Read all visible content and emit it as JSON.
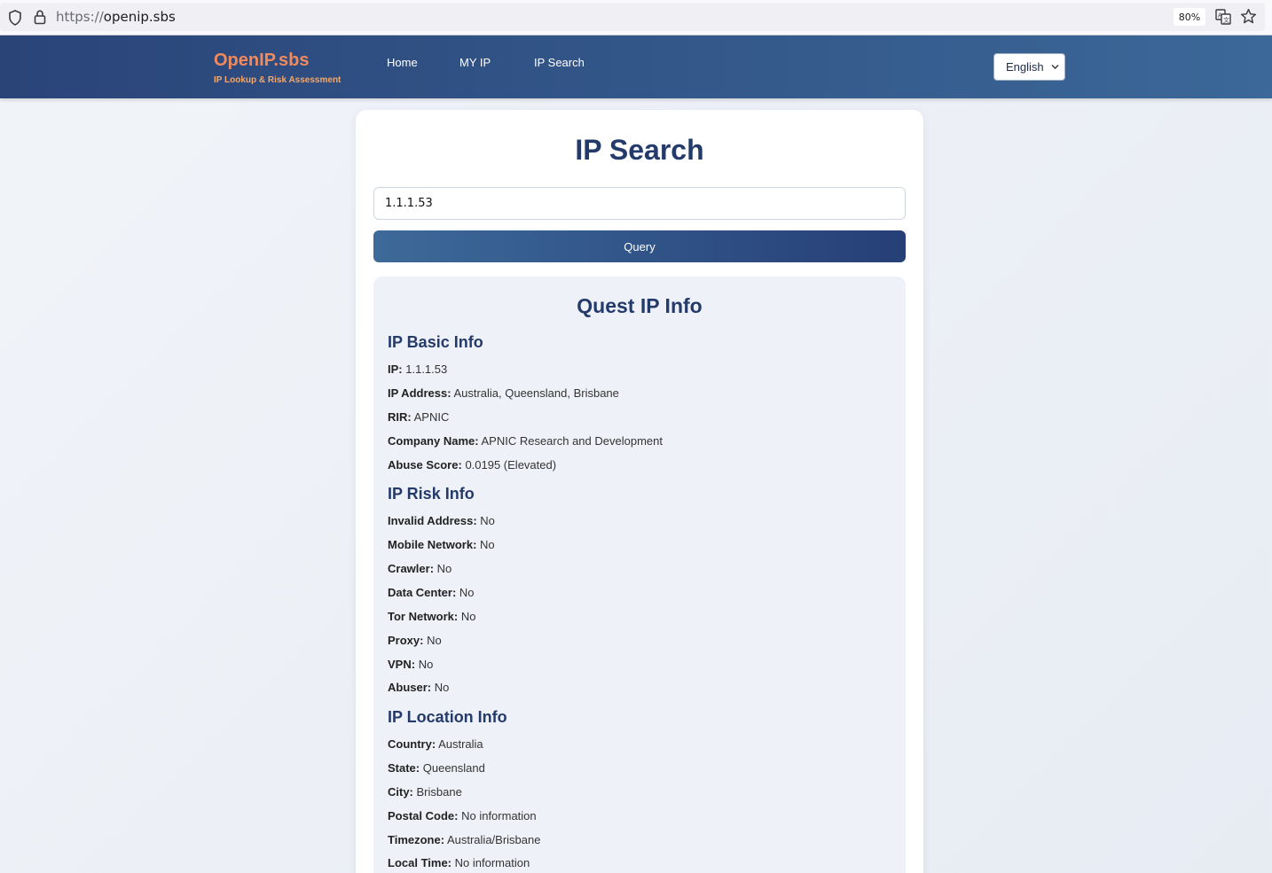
{
  "browser": {
    "url_scheme": "https://",
    "url_host": "openip.sbs",
    "zoom": "80%"
  },
  "header": {
    "logo": "OpenIP.sbs",
    "tagline": "IP Lookup & Risk Assessment",
    "nav": [
      "Home",
      "MY IP",
      "IP Search"
    ],
    "language": "English"
  },
  "main": {
    "title": "IP Search",
    "search_value": "1.1.1.53",
    "query_label": "Query",
    "result_title": "Quest IP Info",
    "sections": [
      {
        "title": "IP Basic Info",
        "rows": [
          {
            "key": "IP:",
            "value": "1.1.1.53"
          },
          {
            "key": "IP Address:",
            "value": "Australia, Queensland, Brisbane"
          },
          {
            "key": "RIR:",
            "value": "APNIC"
          },
          {
            "key": "Company Name:",
            "value": "APNIC Research and Development"
          },
          {
            "key": "Abuse Score:",
            "value": "0.0195 (Elevated)"
          }
        ]
      },
      {
        "title": "IP Risk Info",
        "rows": [
          {
            "key": "Invalid Address:",
            "value": "No"
          },
          {
            "key": "Mobile Network:",
            "value": "No"
          },
          {
            "key": "Crawler:",
            "value": "No"
          },
          {
            "key": "Data Center:",
            "value": "No"
          },
          {
            "key": "Tor Network:",
            "value": "No"
          },
          {
            "key": "Proxy:",
            "value": "No"
          },
          {
            "key": "VPN:",
            "value": "No"
          },
          {
            "key": "Abuser:",
            "value": "No"
          }
        ]
      },
      {
        "title": "IP Location Info",
        "rows": [
          {
            "key": "Country:",
            "value": "Australia"
          },
          {
            "key": "State:",
            "value": "Queensland"
          },
          {
            "key": "City:",
            "value": "Brisbane"
          },
          {
            "key": "Postal Code:",
            "value": "No information"
          },
          {
            "key": "Timezone:",
            "value": "Australia/Brisbane"
          },
          {
            "key": "Local Time:",
            "value": "No information"
          }
        ]
      }
    ]
  },
  "colors": {
    "header_start": "#2a4478",
    "header_end": "#3b6898",
    "logo": "#f08a5d",
    "heading": "#243a6b"
  }
}
